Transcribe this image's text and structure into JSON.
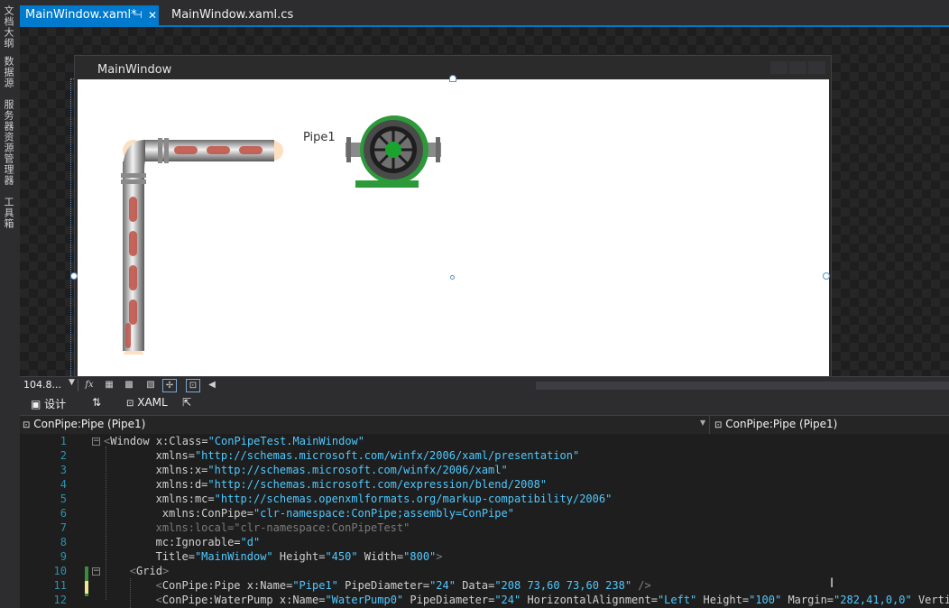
{
  "left_toolbar": [
    "文档大纲",
    "数据源",
    "服务器资源管理器",
    "工具箱"
  ],
  "tabs": [
    {
      "label": "MainWindow.xaml*",
      "active": true,
      "pin": "⊣",
      "close": "✕"
    },
    {
      "label": "MainWindow.xaml.cs",
      "active": false
    }
  ],
  "designer": {
    "window_title": "MainWindow",
    "pipe_label": "Pipe1"
  },
  "zoombar": {
    "zoom": "104.8...",
    "fx": "fx"
  },
  "split_tabs": {
    "design": "设计",
    "swap": "⇅",
    "xaml": "XAML"
  },
  "selector": {
    "left": "ConPipe:Pipe (Pipe1)",
    "right": "ConPipe:Pipe (Pipe1)"
  },
  "code_lines": [
    {
      "n": "1",
      "indent": 0,
      "parts": [
        [
          "brk",
          "<"
        ],
        [
          "el",
          "Window "
        ],
        [
          "attr",
          "x:Class="
        ],
        [
          "str",
          "\"ConPipeTest.MainWindow\""
        ]
      ]
    },
    {
      "n": "2",
      "indent": 8,
      "parts": [
        [
          "attr",
          "xmlns="
        ],
        [
          "str",
          "\"http://schemas.microsoft.com/winfx/2006/xaml/presentation\""
        ]
      ]
    },
    {
      "n": "3",
      "indent": 8,
      "parts": [
        [
          "attr",
          "xmlns:x="
        ],
        [
          "str",
          "\"http://schemas.microsoft.com/winfx/2006/xaml\""
        ]
      ]
    },
    {
      "n": "4",
      "indent": 8,
      "parts": [
        [
          "attr",
          "xmlns:d="
        ],
        [
          "str",
          "\"http://schemas.microsoft.com/expression/blend/2008\""
        ]
      ]
    },
    {
      "n": "5",
      "indent": 8,
      "parts": [
        [
          "attr",
          "xmlns:mc="
        ],
        [
          "str",
          "\"http://schemas.openxmlformats.org/markup-compatibility/2006\""
        ]
      ]
    },
    {
      "n": "6",
      "indent": 9,
      "parts": [
        [
          "attr",
          "xmlns:ConPipe="
        ],
        [
          "str",
          "\"clr-namespace:ConPipe;assembly=ConPipe\""
        ]
      ]
    },
    {
      "n": "7",
      "indent": 8,
      "parts": [
        [
          "dim",
          "xmlns:local=\"clr-namespace:ConPipeTest\""
        ]
      ]
    },
    {
      "n": "8",
      "indent": 8,
      "parts": [
        [
          "attr",
          "mc:Ignorable="
        ],
        [
          "str",
          "\"d\""
        ]
      ]
    },
    {
      "n": "9",
      "indent": 8,
      "parts": [
        [
          "attr",
          "Title="
        ],
        [
          "str",
          "\"MainWindow\""
        ],
        [
          "attr",
          " Height="
        ],
        [
          "str",
          "\"450\""
        ],
        [
          "attr",
          " Width="
        ],
        [
          "str",
          "\"800\""
        ],
        [
          "brk",
          ">"
        ]
      ]
    },
    {
      "n": "10",
      "indent": 4,
      "parts": [
        [
          "brk",
          "<"
        ],
        [
          "el",
          "Grid"
        ],
        [
          "brk",
          ">"
        ]
      ]
    },
    {
      "n": "11",
      "indent": 8,
      "parts": [
        [
          "brk",
          "<"
        ],
        [
          "el",
          "ConPipe:Pipe "
        ],
        [
          "attr",
          "x:Name="
        ],
        [
          "str",
          "\"Pipe1\""
        ],
        [
          "attr",
          " PipeDiameter="
        ],
        [
          "str",
          "\"24\""
        ],
        [
          "attr",
          " Data="
        ],
        [
          "str",
          "\"208 73,60 73,60 238\""
        ],
        [
          "brk",
          " />"
        ]
      ]
    },
    {
      "n": "12",
      "indent": 8,
      "parts": [
        [
          "brk",
          "<"
        ],
        [
          "el",
          "ConPipe:WaterPump "
        ],
        [
          "attr",
          "x:Name="
        ],
        [
          "str",
          "\"WaterPump0\""
        ],
        [
          "attr",
          " PipeDiameter="
        ],
        [
          "str",
          "\"24\""
        ],
        [
          "attr",
          " HorizontalAlignment="
        ],
        [
          "str",
          "\"Left\""
        ],
        [
          "attr",
          " Height="
        ],
        [
          "str",
          "\"100\""
        ],
        [
          "attr",
          " Margin="
        ],
        [
          "str",
          "\"282,41,0,0\""
        ],
        [
          "attr",
          " VerticalA"
        ]
      ]
    }
  ]
}
